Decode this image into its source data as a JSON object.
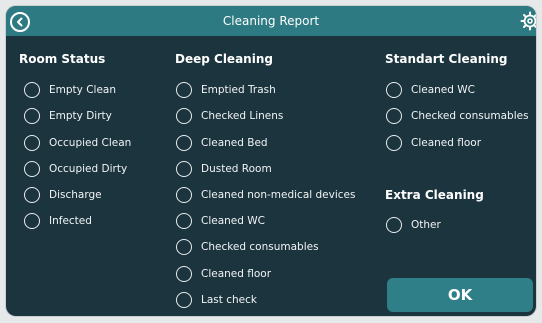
{
  "title": "Cleaning Report",
  "room_status": {
    "heading": "Room Status",
    "options": [
      "Empty Clean",
      "Empty Dirty",
      "Occupied Clean",
      "Occupied Dirty",
      "Discharge",
      "Infected"
    ]
  },
  "deep_cleaning": {
    "heading": "Deep Cleaning",
    "options": [
      "Emptied Trash",
      "Checked Linens",
      "Cleaned Bed",
      "Dusted Room",
      "Cleaned non-medical devices",
      "Cleaned WC",
      "Checked consumables",
      "Cleaned floor",
      "Last check"
    ]
  },
  "standart_cleaning": {
    "heading": "Standart Cleaning",
    "options": [
      "Cleaned WC",
      "Checked consumables",
      "Cleaned floor"
    ]
  },
  "extra_cleaning": {
    "heading": "Extra Cleaning",
    "options": [
      "Other"
    ]
  },
  "ok_label": "OK",
  "icons": {
    "back": "back-icon",
    "settings": "gear-icon"
  },
  "colors": {
    "background": "#1b343e",
    "header": "#2d7a82",
    "button": "#2f7f88"
  }
}
